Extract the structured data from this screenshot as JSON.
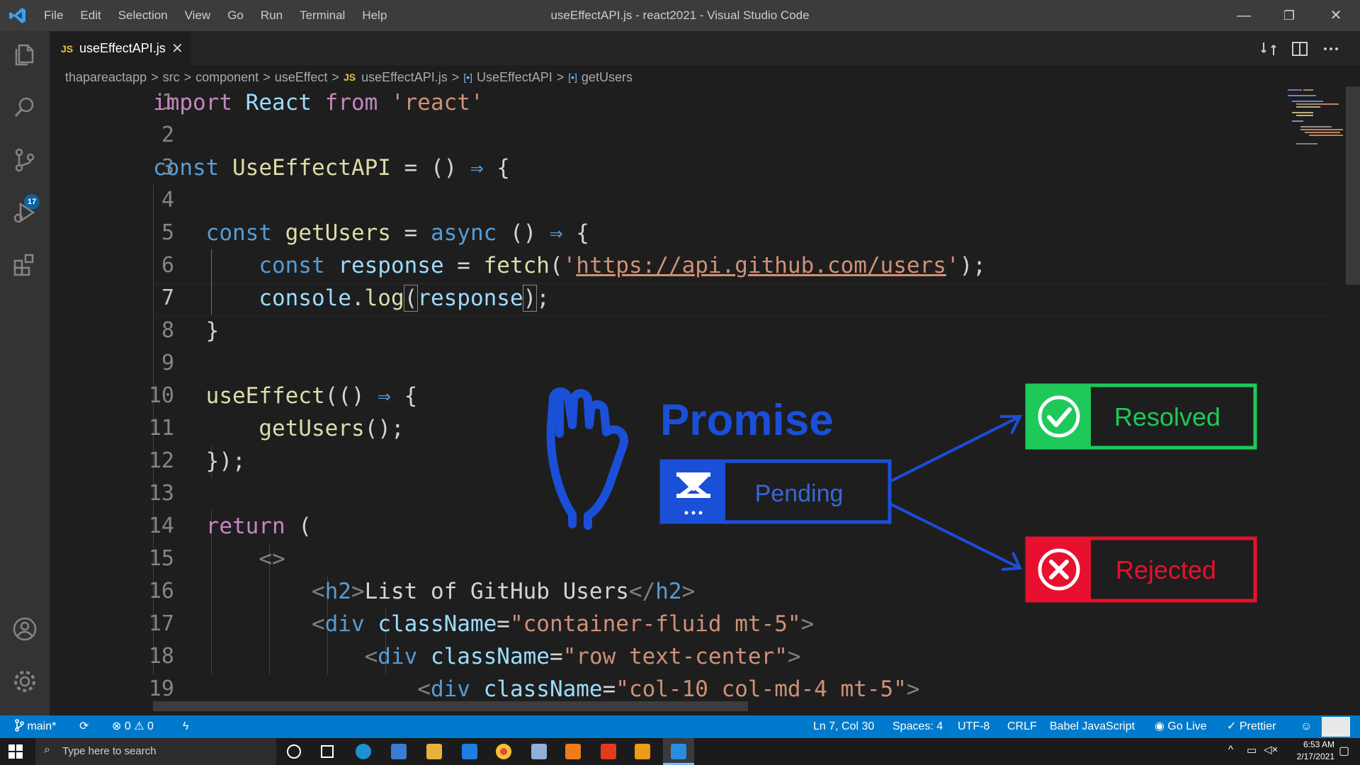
{
  "window": {
    "title": "useEffectAPI.js - react2021 - Visual Studio Code",
    "menu": [
      "File",
      "Edit",
      "Selection",
      "View",
      "Go",
      "Run",
      "Terminal",
      "Help"
    ],
    "minimize_glyph": "—",
    "restore_glyph": "❐",
    "close_glyph": "✕"
  },
  "activity_bar": {
    "items": [
      "explorer-icon",
      "search-icon",
      "source-control-icon",
      "run-debug-icon",
      "extensions-icon",
      "accounts-icon",
      "gear-icon"
    ],
    "scm_badge": "17"
  },
  "tab": {
    "lang": "JS",
    "name": "useEffectAPI.js",
    "close": "✕"
  },
  "breadcrumbs": {
    "items": [
      "thapareactapp",
      "src",
      "component",
      "useEffect"
    ],
    "file_lang": "JS",
    "file": "useEffectAPI.js",
    "symbol1": "UseEffectAPI",
    "symbol2": "getUsers",
    "symbol_glyph": "[•]",
    "sep": ">"
  },
  "editor": {
    "current_line": 7,
    "line_numbers": [
      "1",
      "2",
      "3",
      "4",
      "5",
      "6",
      "7",
      "8",
      "9",
      "10",
      "11",
      "12",
      "13",
      "14",
      "15",
      "16",
      "17",
      "18",
      "19"
    ]
  },
  "diagram": {
    "title": "Promise",
    "pending": "Pending",
    "resolved": "Resolved",
    "rejected": "Rejected",
    "colors": {
      "blue": "#1a4fd8",
      "green": "#1ec95a",
      "red": "#e8102e"
    }
  },
  "status_bar": {
    "branch": "main*",
    "errors": "0",
    "warnings": "0",
    "position": "Ln 7, Col 30",
    "spaces": "Spaces: 4",
    "encoding": "UTF-8",
    "eol": "CRLF",
    "language": "Babel JavaScript",
    "golive": "Go Live",
    "prettier": "Prettier"
  },
  "taskbar": {
    "search_placeholder": "Type here to search",
    "time": "6:53 AM",
    "date": "2/17/2021"
  }
}
